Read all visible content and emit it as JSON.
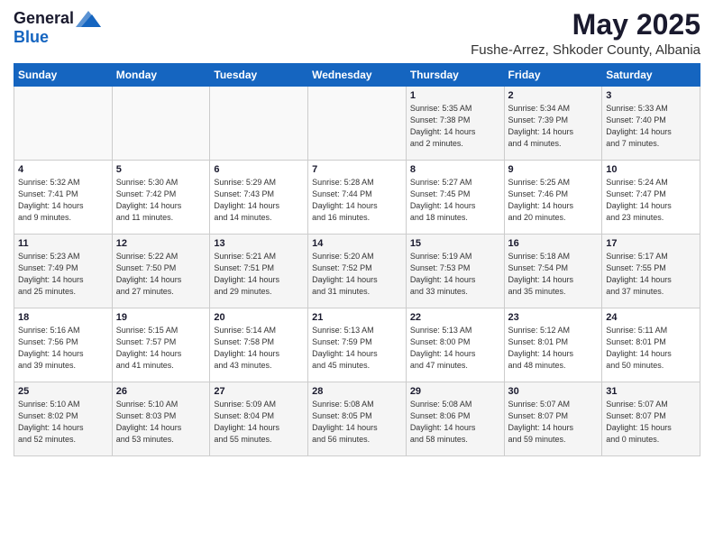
{
  "header": {
    "logo_general": "General",
    "logo_blue": "Blue",
    "month_title": "May 2025",
    "location": "Fushe-Arrez, Shkoder County, Albania"
  },
  "days_of_week": [
    "Sunday",
    "Monday",
    "Tuesday",
    "Wednesday",
    "Thursday",
    "Friday",
    "Saturday"
  ],
  "weeks": [
    [
      {
        "day": "",
        "info": ""
      },
      {
        "day": "",
        "info": ""
      },
      {
        "day": "",
        "info": ""
      },
      {
        "day": "",
        "info": ""
      },
      {
        "day": "1",
        "info": "Sunrise: 5:35 AM\nSunset: 7:38 PM\nDaylight: 14 hours\nand 2 minutes."
      },
      {
        "day": "2",
        "info": "Sunrise: 5:34 AM\nSunset: 7:39 PM\nDaylight: 14 hours\nand 4 minutes."
      },
      {
        "day": "3",
        "info": "Sunrise: 5:33 AM\nSunset: 7:40 PM\nDaylight: 14 hours\nand 7 minutes."
      }
    ],
    [
      {
        "day": "4",
        "info": "Sunrise: 5:32 AM\nSunset: 7:41 PM\nDaylight: 14 hours\nand 9 minutes."
      },
      {
        "day": "5",
        "info": "Sunrise: 5:30 AM\nSunset: 7:42 PM\nDaylight: 14 hours\nand 11 minutes."
      },
      {
        "day": "6",
        "info": "Sunrise: 5:29 AM\nSunset: 7:43 PM\nDaylight: 14 hours\nand 14 minutes."
      },
      {
        "day": "7",
        "info": "Sunrise: 5:28 AM\nSunset: 7:44 PM\nDaylight: 14 hours\nand 16 minutes."
      },
      {
        "day": "8",
        "info": "Sunrise: 5:27 AM\nSunset: 7:45 PM\nDaylight: 14 hours\nand 18 minutes."
      },
      {
        "day": "9",
        "info": "Sunrise: 5:25 AM\nSunset: 7:46 PM\nDaylight: 14 hours\nand 20 minutes."
      },
      {
        "day": "10",
        "info": "Sunrise: 5:24 AM\nSunset: 7:47 PM\nDaylight: 14 hours\nand 23 minutes."
      }
    ],
    [
      {
        "day": "11",
        "info": "Sunrise: 5:23 AM\nSunset: 7:49 PM\nDaylight: 14 hours\nand 25 minutes."
      },
      {
        "day": "12",
        "info": "Sunrise: 5:22 AM\nSunset: 7:50 PM\nDaylight: 14 hours\nand 27 minutes."
      },
      {
        "day": "13",
        "info": "Sunrise: 5:21 AM\nSunset: 7:51 PM\nDaylight: 14 hours\nand 29 minutes."
      },
      {
        "day": "14",
        "info": "Sunrise: 5:20 AM\nSunset: 7:52 PM\nDaylight: 14 hours\nand 31 minutes."
      },
      {
        "day": "15",
        "info": "Sunrise: 5:19 AM\nSunset: 7:53 PM\nDaylight: 14 hours\nand 33 minutes."
      },
      {
        "day": "16",
        "info": "Sunrise: 5:18 AM\nSunset: 7:54 PM\nDaylight: 14 hours\nand 35 minutes."
      },
      {
        "day": "17",
        "info": "Sunrise: 5:17 AM\nSunset: 7:55 PM\nDaylight: 14 hours\nand 37 minutes."
      }
    ],
    [
      {
        "day": "18",
        "info": "Sunrise: 5:16 AM\nSunset: 7:56 PM\nDaylight: 14 hours\nand 39 minutes."
      },
      {
        "day": "19",
        "info": "Sunrise: 5:15 AM\nSunset: 7:57 PM\nDaylight: 14 hours\nand 41 minutes."
      },
      {
        "day": "20",
        "info": "Sunrise: 5:14 AM\nSunset: 7:58 PM\nDaylight: 14 hours\nand 43 minutes."
      },
      {
        "day": "21",
        "info": "Sunrise: 5:13 AM\nSunset: 7:59 PM\nDaylight: 14 hours\nand 45 minutes."
      },
      {
        "day": "22",
        "info": "Sunrise: 5:13 AM\nSunset: 8:00 PM\nDaylight: 14 hours\nand 47 minutes."
      },
      {
        "day": "23",
        "info": "Sunrise: 5:12 AM\nSunset: 8:01 PM\nDaylight: 14 hours\nand 48 minutes."
      },
      {
        "day": "24",
        "info": "Sunrise: 5:11 AM\nSunset: 8:01 PM\nDaylight: 14 hours\nand 50 minutes."
      }
    ],
    [
      {
        "day": "25",
        "info": "Sunrise: 5:10 AM\nSunset: 8:02 PM\nDaylight: 14 hours\nand 52 minutes."
      },
      {
        "day": "26",
        "info": "Sunrise: 5:10 AM\nSunset: 8:03 PM\nDaylight: 14 hours\nand 53 minutes."
      },
      {
        "day": "27",
        "info": "Sunrise: 5:09 AM\nSunset: 8:04 PM\nDaylight: 14 hours\nand 55 minutes."
      },
      {
        "day": "28",
        "info": "Sunrise: 5:08 AM\nSunset: 8:05 PM\nDaylight: 14 hours\nand 56 minutes."
      },
      {
        "day": "29",
        "info": "Sunrise: 5:08 AM\nSunset: 8:06 PM\nDaylight: 14 hours\nand 58 minutes."
      },
      {
        "day": "30",
        "info": "Sunrise: 5:07 AM\nSunset: 8:07 PM\nDaylight: 14 hours\nand 59 minutes."
      },
      {
        "day": "31",
        "info": "Sunrise: 5:07 AM\nSunset: 8:07 PM\nDaylight: 15 hours\nand 0 minutes."
      }
    ]
  ]
}
